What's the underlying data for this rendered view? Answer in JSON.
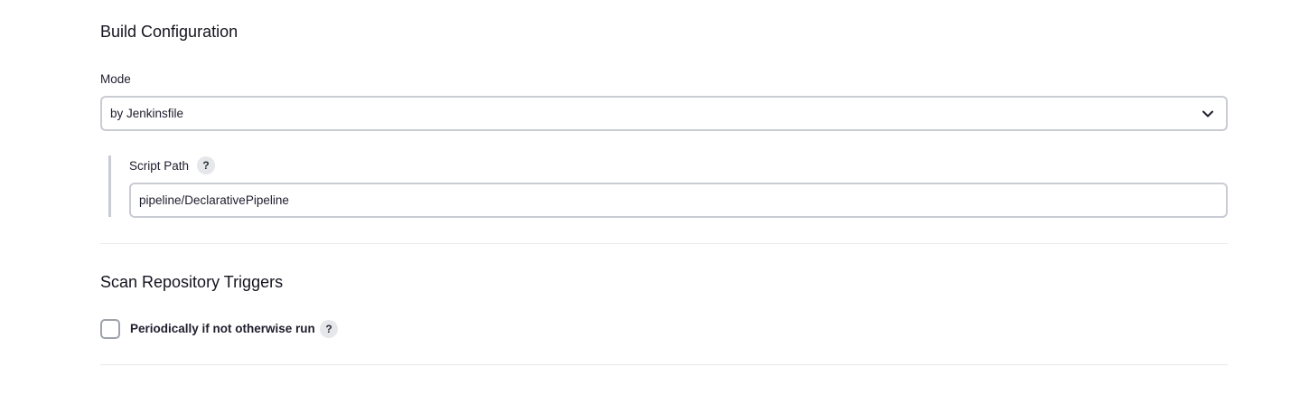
{
  "build_configuration": {
    "title": "Build Configuration",
    "mode": {
      "label": "Mode",
      "selected": "by Jenkinsfile",
      "icon": "chevron-down-icon"
    },
    "script_path": {
      "label": "Script Path",
      "help": "?",
      "value": "pipeline/DeclarativePipeline"
    }
  },
  "scan_repository_triggers": {
    "title": "Scan Repository Triggers",
    "periodic": {
      "label": "Periodically if not otherwise run",
      "help": "?",
      "checked": false
    }
  }
}
